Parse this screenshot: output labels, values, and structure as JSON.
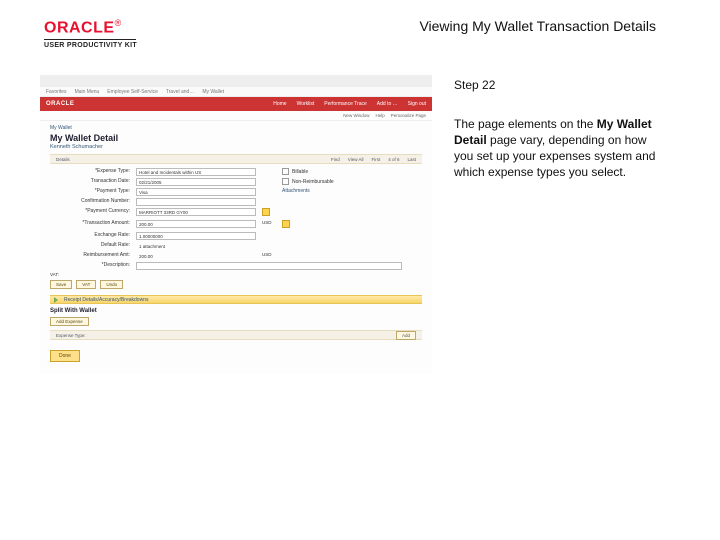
{
  "header": {
    "brand_main": "ORACLE",
    "brand_reg": "®",
    "brand_sub": "USER PRODUCTIVITY KIT",
    "page_title": "Viewing My Wallet Transaction Details"
  },
  "instruction": {
    "step_label": "Step 22",
    "para_pre": "The page elements on the ",
    "para_bold": "My Wallet Detail",
    "para_post": " page vary, depending on how you set up your expenses system and which expense types you select."
  },
  "screenshot": {
    "menubar": [
      "Favorites",
      "Main Menu",
      "Employee Self-Service",
      "Travel and…",
      "My Wallet"
    ],
    "rednav": {
      "brand": "ORACLE",
      "links": [
        "Home",
        "Worklist",
        "Performance Trace",
        "Add to …",
        "Sign out"
      ]
    },
    "subnav": [
      "New Window",
      "Help",
      "Personalize Page"
    ],
    "breadcrumb": "My Wallet",
    "title": "My Wallet Detail",
    "subtitle": "Kenneth Schumacher",
    "tabrow": {
      "left": "Details",
      "links": [
        "Find",
        "View All",
        "First",
        "4 of 6",
        "Last"
      ]
    },
    "form": {
      "rows": [
        {
          "label": "*Expense Type:",
          "value": "Hotel and Incidentals within US",
          "right_ck": "Billable"
        },
        {
          "label": "Transaction Date:",
          "value": "02/21/2005",
          "right_ck": "Non-Reimbursable"
        },
        {
          "label": "*Payment Type:",
          "value": "Visa",
          "right_link": "Attachments"
        },
        {
          "label": "Confirmation Number:",
          "value": ""
        },
        {
          "label": "*Payment Currency:",
          "value": "MARRIOTT 33RD GY00",
          "icon": true
        },
        {
          "label": "*Transaction Amount:",
          "value": "200.00",
          "curr": "USD",
          "icon": true
        },
        {
          "label": "Exchange Rate:",
          "value": "1.00000000"
        },
        {
          "label": "Default Rate:",
          "note": true
        },
        {
          "label": "Reimbursement Amt:",
          "value": "200.00",
          "ro": true,
          "curr": "USD"
        },
        {
          "label": "*Description:",
          "value": ""
        }
      ],
      "note_text": "1 attachment",
      "vat_label": "VAT:",
      "vat_btns": [
        "Save",
        "VAT",
        "Undo"
      ]
    },
    "ybar1": "Receipt Details/Accuracy/Breakdowns",
    "split_title": "Split With Wallet",
    "add_expense_btn": "Add Expense",
    "split_row": {
      "label": "Expense Type:",
      "add": "Add"
    },
    "done_btn": "Done"
  }
}
